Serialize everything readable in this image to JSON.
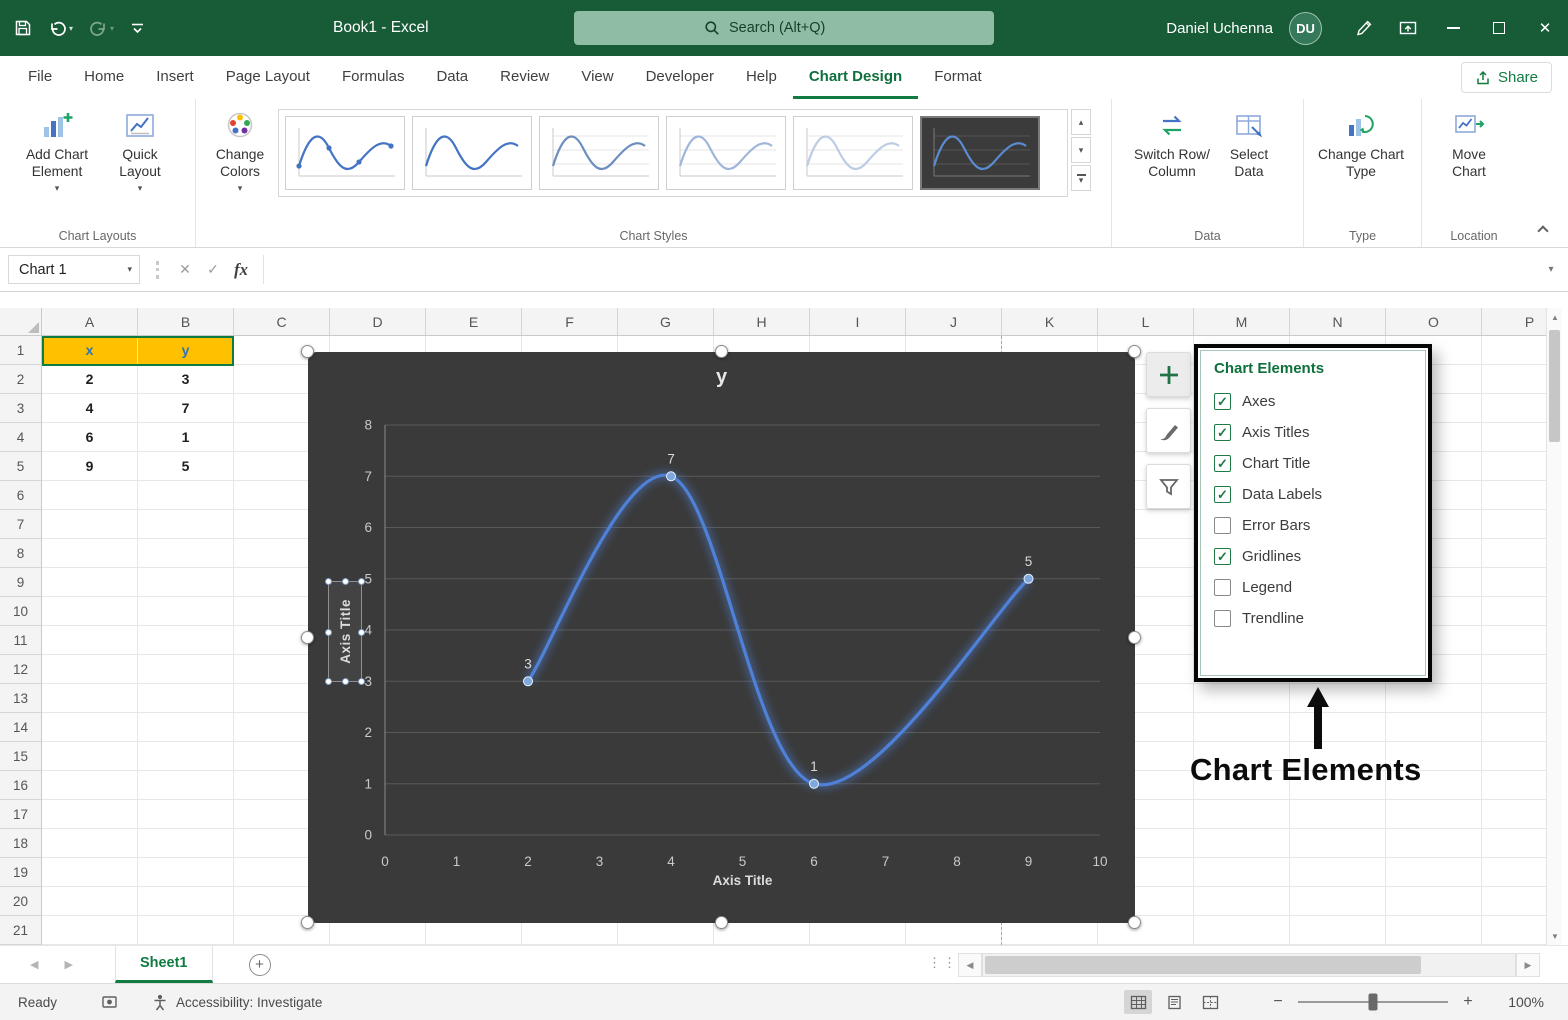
{
  "colors": {
    "titlebar": "#185C37",
    "accent": "#107C41",
    "cell_highlight": "#FFC000",
    "cell_highlight_text": "#2E75B6",
    "chart_background": "#3A3A3A",
    "chart_line": "#4F81D8"
  },
  "icons": {
    "dropdown": "▾",
    "gallery_up": "▴",
    "gallery_down": "▾",
    "check": "✓",
    "close": "✕",
    "scroll_up": "▲",
    "scroll_down": "▼",
    "scroll_left": "◀",
    "scroll_right": "▶",
    "plus": "+",
    "minus": "−"
  },
  "titlebar": {
    "title": "Book1  -  Excel",
    "search": "Search (Alt+Q)",
    "user": "Daniel Uchenna",
    "initials": "DU"
  },
  "tabs": [
    {
      "label": "File"
    },
    {
      "label": "Home"
    },
    {
      "label": "Insert"
    },
    {
      "label": "Page Layout"
    },
    {
      "label": "Formulas"
    },
    {
      "label": "Data"
    },
    {
      "label": "Review"
    },
    {
      "label": "View"
    },
    {
      "label": "Developer"
    },
    {
      "label": "Help"
    },
    {
      "label": "Chart Design",
      "active": true
    },
    {
      "label": "Format"
    }
  ],
  "share": {
    "label": "Share"
  },
  "ribbon": {
    "add_chart_element": "Add Chart Element",
    "quick_layout": "Quick Layout",
    "change_colors": "Change Colors",
    "switch_row_column": "Switch Row/ Column",
    "select_data": "Select Data",
    "change_chart_type": "Change Chart Type",
    "move_chart": "Move Chart",
    "groups": {
      "layouts": "Chart Layouts",
      "styles": "Chart Styles",
      "data": "Data",
      "type": "Type",
      "location": "Location"
    }
  },
  "formula_bar": {
    "name_box": "Chart 1",
    "fx": "fx"
  },
  "grid": {
    "columns": [
      "A",
      "B",
      "C",
      "D",
      "E",
      "F",
      "G",
      "H",
      "I",
      "J",
      "K",
      "L",
      "M",
      "N",
      "O",
      "P"
    ],
    "row_count": 21,
    "cells": {
      "A1": "x",
      "B1": "y",
      "A2": "2",
      "B2": "3",
      "A3": "4",
      "B3": "7",
      "A4": "6",
      "B4": "1",
      "A5": "9",
      "B5": "5"
    },
    "highlighted": [
      "A1",
      "B1"
    ]
  },
  "chart_data": {
    "type": "line",
    "title": "y",
    "x": [
      2,
      4,
      6,
      9
    ],
    "y": [
      3,
      7,
      1,
      5
    ],
    "data_labels": [
      "3",
      "7",
      "1",
      "5"
    ],
    "xlabel": "Axis Title",
    "ylabel": "Axis Title",
    "xlim": [
      0,
      10
    ],
    "ylim": [
      0,
      8
    ],
    "x_ticks": [
      0,
      1,
      2,
      3,
      4,
      5,
      6,
      7,
      8,
      9,
      10
    ],
    "y_ticks": [
      0,
      1,
      2,
      3,
      4,
      5,
      6,
      7,
      8
    ],
    "gridlines": "horizontal",
    "legend": "none",
    "line_color": "#4F81D8",
    "background": "#3A3A3A"
  },
  "chart_elements": {
    "title": "Chart Elements",
    "items": [
      {
        "label": "Axes",
        "checked": true
      },
      {
        "label": "Axis Titles",
        "checked": true
      },
      {
        "label": "Chart Title",
        "checked": true
      },
      {
        "label": "Data Labels",
        "checked": true
      },
      {
        "label": "Error Bars",
        "checked": false
      },
      {
        "label": "Gridlines",
        "checked": true
      },
      {
        "label": "Legend",
        "checked": false
      },
      {
        "label": "Trendline",
        "checked": false
      }
    ]
  },
  "annotation": {
    "label": "Chart Elements"
  },
  "sheet_bar": {
    "active_sheet": "Sheet1"
  },
  "status_bar": {
    "ready": "Ready",
    "accessibility": "Accessibility: Investigate",
    "zoom": "100%"
  }
}
